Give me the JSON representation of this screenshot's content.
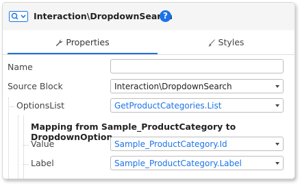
{
  "header": {
    "title": "Interaction\\DropdownSearch",
    "help_label": "?"
  },
  "tabs": [
    {
      "label": "Properties",
      "icon": "wrench-icon",
      "active": true
    },
    {
      "label": "Styles",
      "icon": "brush-icon",
      "active": false
    }
  ],
  "properties": {
    "name": {
      "label": "Name",
      "value": ""
    },
    "source_block": {
      "label": "Source Block",
      "value": "Interaction\\DropdownSearch"
    },
    "options_list": {
      "label": "OptionsList",
      "value": "GetProductCategories.List"
    },
    "mapping": {
      "title": "Mapping from Sample_ProductCategory to DropdownOption",
      "value": {
        "label": "Value",
        "value": "Sample_ProductCategory.Id"
      },
      "label": {
        "label": "Label",
        "value": "Sample_ProductCategory.Label"
      }
    }
  },
  "colors": {
    "accent": "#1a73e8",
    "tab_underline": "#1f6fd8"
  }
}
